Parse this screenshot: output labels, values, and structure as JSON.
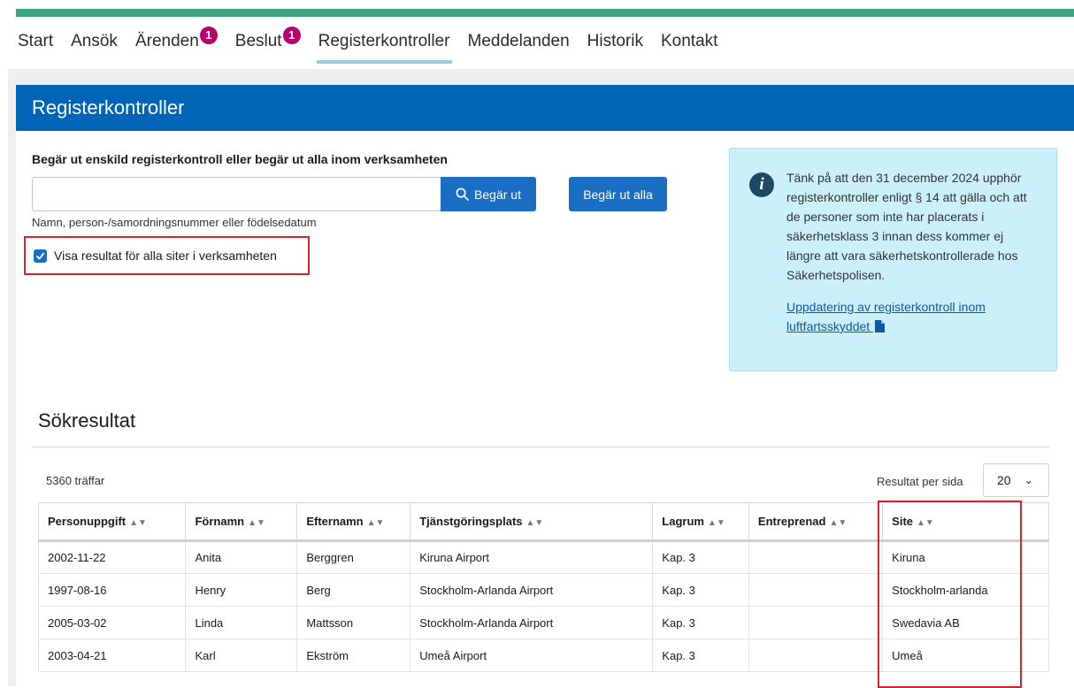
{
  "nav": {
    "items": [
      {
        "label": "Start",
        "badge": ""
      },
      {
        "label": "Ansök",
        "badge": ""
      },
      {
        "label": "Ärenden",
        "badge": "1"
      },
      {
        "label": "Beslut",
        "badge": "1"
      },
      {
        "label": "Registerkontroller",
        "badge": "",
        "active": true
      },
      {
        "label": "Meddelanden",
        "badge": ""
      },
      {
        "label": "Historik",
        "badge": ""
      },
      {
        "label": "Kontakt",
        "badge": ""
      }
    ]
  },
  "panel": {
    "title": "Registerkontroller"
  },
  "search": {
    "label": "Begär ut enskild registerkontroll eller begär ut alla inom verksamheten",
    "value": "",
    "hint": "Namn, person-/samordningsnummer eller födelsedatum",
    "button_label": "Begär ut",
    "all_button_label": "Begär ut alla",
    "checkbox_label": "Visa resultat för alla siter i verksamheten",
    "checkbox_checked": true
  },
  "info": {
    "text": "Tänk på att den 31 december 2024 upphör registerkontroller enligt § 14 att gälla och att de personer som inte har placerats i säkerhetsklass 3 innan dess kommer ej längre att vara säkerhetskontrollerade hos Säkerhetspolisen.",
    "link_text": "Uppdatering av registerkontroll inom luftfartsskyddet"
  },
  "results": {
    "title": "Sökresultat",
    "hits": "5360 träffar",
    "per_page_label": "Resultat per sida",
    "per_page_value": "20",
    "columns": [
      "Personuppgift",
      "Förnamn",
      "Efternamn",
      "Tjänstgöringsplats",
      "Lagrum",
      "Entreprenad",
      "Site"
    ],
    "rows": [
      [
        "2002-11-22",
        "Anita",
        "Berggren",
        "Kiruna Airport",
        "Kap. 3",
        "",
        "Kiruna"
      ],
      [
        "1997-08-16",
        "Henry",
        "Berg",
        "Stockholm-Arlanda Airport",
        "Kap. 3",
        "",
        "Stockholm-arlanda"
      ],
      [
        "2005-03-02",
        "Linda",
        "Mattsson",
        "Stockholm-Arlanda Airport",
        "Kap. 3",
        "",
        "Swedavia AB"
      ],
      [
        "2003-04-21",
        "Karl",
        "Ekström",
        "Umeå Airport",
        "Kap. 3",
        "",
        "Umeå"
      ]
    ]
  },
  "colors": {
    "nav_accent": "#3fa77d",
    "header_blue": "#0064b7",
    "button_blue": "#1a6fc4",
    "badge": "#b5006d",
    "highlight": "#d7232f",
    "info_bg": "#ccf0f9"
  }
}
